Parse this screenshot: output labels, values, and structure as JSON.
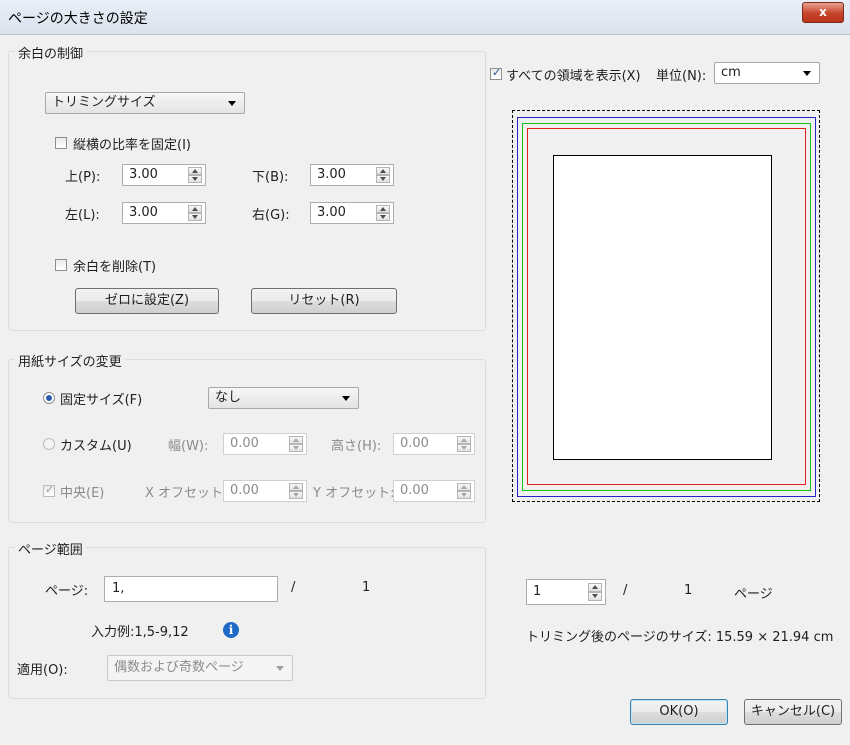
{
  "window": {
    "title": "ページの大きさの設定",
    "close_label": "x"
  },
  "margin_group": {
    "legend": "余白の制御",
    "mode_select": "トリミングサイズ",
    "lock_ratio_label": "縦横の比率を固定(I)",
    "top_label": "上(P):",
    "top_value": "3.00",
    "bottom_label": "下(B):",
    "bottom_value": "3.00",
    "left_label": "左(L):",
    "left_value": "3.00",
    "right_label": "右(G):",
    "right_value": "3.00",
    "remove_margin_label": "余白を削除(T)",
    "zero_button": "ゼロに設定(Z)",
    "reset_button": "リセット(R)"
  },
  "paper_group": {
    "legend": "用紙サイズの変更",
    "fixed_label": "固定サイズ(F)",
    "fixed_select": "なし",
    "custom_label": "カスタム(U)",
    "width_label": "幅(W):",
    "width_value": "0.00",
    "height_label": "高さ(H):",
    "height_value": "0.00",
    "center_label": "中央(E)",
    "x_offset_label": "X オフセット:",
    "x_offset_value": "0.00",
    "y_offset_label": "Y オフセット:",
    "y_offset_value": "0.00"
  },
  "range_group": {
    "legend": "ページ範囲",
    "pages_label": "ページ:",
    "pages_value": "1,",
    "slash": "/",
    "total": "1",
    "example": "入力例:1,5-9,12",
    "apply_label": "適用(O):",
    "apply_select": "偶数および奇数ページ"
  },
  "preview": {
    "show_all_label": "すべての領域を表示(X)",
    "unit_label": "単位(N):",
    "unit_value": "cm",
    "page_value": "1",
    "slash": "/",
    "page_total": "1",
    "page_suffix": "ページ",
    "trimmed_size": "トリミング後のページのサイズ:  15.59 × 21.94  cm"
  },
  "buttons": {
    "ok": "OK(O)",
    "cancel": "キャンセル(C)"
  }
}
